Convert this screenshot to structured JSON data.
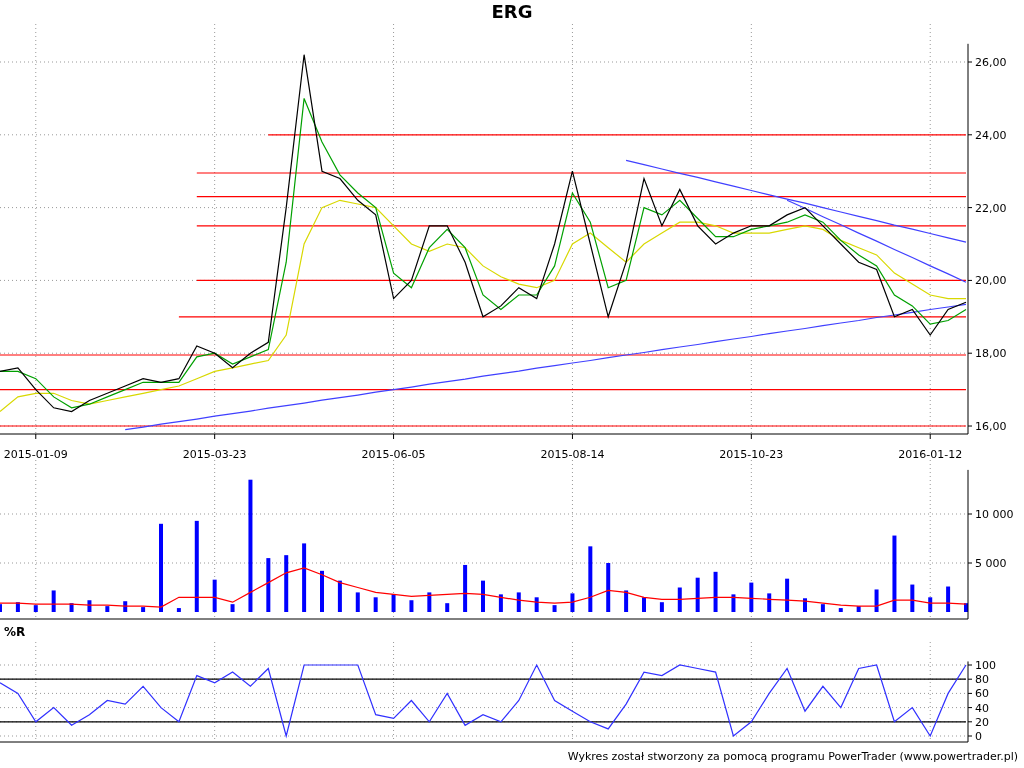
{
  "title": "ERG",
  "price_chart": {
    "chart_data": {
      "type": "line",
      "grid": true,
      "categories": [
        null,
        null,
        "2015-01-09",
        null,
        null,
        null,
        null,
        null,
        null,
        null,
        null,
        null,
        "2015-03-23",
        null,
        null,
        null,
        null,
        null,
        null,
        null,
        null,
        null,
        "2015-06-05",
        null,
        null,
        null,
        null,
        null,
        null,
        null,
        null,
        null,
        "2015-08-14",
        null,
        null,
        null,
        null,
        null,
        null,
        null,
        null,
        null,
        "2015-10-23",
        null,
        null,
        null,
        null,
        null,
        null,
        null,
        null,
        null,
        "2016-01-12",
        null,
        null
      ],
      "ylim": [
        15.8,
        26.5
      ],
      "yticks": [
        {
          "value": 16,
          "label": "16,00"
        },
        {
          "value": 18,
          "label": "18,00"
        },
        {
          "value": 20,
          "label": "20,00"
        },
        {
          "value": 22,
          "label": "22,00"
        },
        {
          "value": 24,
          "label": "24,00"
        },
        {
          "value": 26,
          "label": "26,00"
        }
      ],
      "series": [
        {
          "color": "#ff0000",
          "values": [
            null,
            null,
            null,
            null,
            null,
            null,
            null,
            null,
            null,
            null,
            null,
            null,
            null,
            null,
            null,
            24,
            24,
            24,
            24,
            24,
            24,
            24,
            24,
            24,
            24,
            24,
            24,
            24,
            24,
            24,
            24,
            24,
            24,
            24,
            24,
            24,
            24,
            24,
            24,
            24,
            24,
            24,
            24,
            24,
            24,
            24,
            24,
            24,
            24,
            24,
            24,
            24,
            24,
            24,
            24
          ]
        },
        {
          "color": "#ff0000",
          "values": [
            null,
            null,
            null,
            null,
            null,
            null,
            null,
            null,
            null,
            null,
            null,
            22.95,
            22.95,
            22.95,
            22.95,
            22.95,
            22.95,
            22.95,
            22.95,
            22.95,
            22.95,
            22.95,
            22.95,
            22.95,
            22.95,
            22.95,
            22.95,
            22.95,
            22.95,
            22.95,
            22.95,
            22.95,
            22.95,
            22.95,
            22.95,
            22.95,
            22.95,
            22.95,
            22.95,
            22.95,
            22.95,
            22.95,
            22.95,
            22.95,
            22.95,
            22.95,
            22.95,
            22.95,
            22.95,
            22.95,
            22.95,
            22.95,
            22.95,
            22.95,
            22.95
          ]
        },
        {
          "color": "#ff0000",
          "values": [
            null,
            null,
            null,
            null,
            null,
            null,
            null,
            null,
            null,
            null,
            null,
            22.3,
            22.3,
            22.3,
            22.3,
            22.3,
            22.3,
            22.3,
            22.3,
            22.3,
            22.3,
            22.3,
            22.3,
            22.3,
            22.3,
            22.3,
            22.3,
            22.3,
            22.3,
            22.3,
            22.3,
            22.3,
            22.3,
            22.3,
            22.3,
            22.3,
            22.3,
            22.3,
            22.3,
            22.3,
            22.3,
            22.3,
            22.3,
            22.3,
            22.3,
            22.3,
            22.3,
            22.3,
            22.3,
            22.3,
            22.3,
            22.3,
            22.3,
            22.3,
            22.3
          ]
        },
        {
          "color": "#ff0000",
          "values": [
            null,
            null,
            null,
            null,
            null,
            null,
            null,
            null,
            null,
            null,
            null,
            21.5,
            21.5,
            21.5,
            21.5,
            21.5,
            21.5,
            21.5,
            21.5,
            21.5,
            21.5,
            21.5,
            21.5,
            21.5,
            21.5,
            21.5,
            21.5,
            21.5,
            21.5,
            21.5,
            21.5,
            21.5,
            21.5,
            21.5,
            21.5,
            21.5,
            21.5,
            21.5,
            21.5,
            21.5,
            21.5,
            21.5,
            21.5,
            21.5,
            21.5,
            21.5,
            21.5,
            21.5,
            21.5,
            21.5,
            21.5,
            21.5,
            21.5,
            21.5,
            21.5
          ]
        },
        {
          "color": "#ff0000",
          "values": [
            null,
            null,
            null,
            null,
            null,
            null,
            null,
            null,
            null,
            null,
            null,
            20,
            20,
            20,
            20,
            20,
            20,
            20,
            20,
            20,
            20,
            20,
            20,
            20,
            20,
            20,
            20,
            20,
            20,
            20,
            20,
            20,
            20,
            20,
            20,
            20,
            20,
            20,
            20,
            20,
            20,
            20,
            20,
            20,
            20,
            20,
            20,
            20,
            20,
            20,
            20,
            20,
            20,
            20,
            20
          ]
        },
        {
          "color": "#ff0000",
          "values": [
            null,
            null,
            null,
            null,
            null,
            null,
            null,
            null,
            null,
            null,
            19,
            19,
            19,
            19,
            19,
            19,
            19,
            19,
            19,
            19,
            19,
            19,
            19,
            19,
            19,
            19,
            19,
            19,
            19,
            19,
            19,
            19,
            19,
            19,
            19,
            19,
            19,
            19,
            19,
            19,
            19,
            19,
            19,
            19,
            19,
            19,
            19,
            19,
            19,
            19,
            19,
            19,
            19,
            19,
            19
          ]
        },
        {
          "color": "#ff0000",
          "values": [
            17.95,
            17.95,
            17.95,
            17.95,
            17.95,
            17.95,
            17.95,
            17.95,
            17.95,
            17.95,
            17.95,
            17.95,
            17.95,
            17.95,
            17.95,
            17.95,
            17.95,
            17.95,
            17.95,
            17.95,
            17.95,
            17.95,
            17.95,
            17.95,
            17.95,
            17.95,
            17.95,
            17.95,
            17.95,
            17.95,
            17.95,
            17.95,
            17.95,
            17.95,
            17.95,
            17.95,
            17.95,
            17.95,
            17.95,
            17.95,
            17.95,
            17.95,
            17.95,
            17.95,
            17.95,
            17.95,
            17.95,
            17.95,
            17.95,
            17.95,
            17.95,
            17.95,
            17.95,
            17.95,
            17.95
          ]
        },
        {
          "color": "#ff0000",
          "values": [
            17,
            17,
            17,
            17,
            17,
            17,
            17,
            17,
            17,
            17,
            17,
            17,
            17,
            17,
            17,
            17,
            17,
            17,
            17,
            17,
            17,
            17,
            17,
            17,
            17,
            17,
            17,
            17,
            17,
            17,
            17,
            17,
            17,
            17,
            17,
            17,
            17,
            17,
            17,
            17,
            17,
            17,
            17,
            17,
            17,
            17,
            17,
            17,
            17,
            17,
            17,
            17,
            17,
            17,
            17
          ]
        },
        {
          "color": "#ff0000",
          "values": [
            16,
            16,
            16,
            16,
            16,
            16,
            16,
            16,
            16,
            16,
            16,
            16,
            16,
            16,
            16,
            16,
            16,
            16,
            16,
            16,
            16,
            16,
            16,
            16,
            16,
            16,
            16,
            16,
            16,
            16,
            16,
            16,
            16,
            16,
            16,
            16,
            16,
            16,
            16,
            16,
            16,
            16,
            16,
            16,
            16,
            16,
            16,
            16,
            16,
            16,
            16,
            16,
            16,
            16,
            16
          ]
        },
        {
          "color": "#4040ff",
          "values": [
            null,
            null,
            null,
            null,
            null,
            null,
            null,
            15.9,
            15.97,
            16.05,
            16.12,
            16.19,
            16.27,
            16.34,
            16.41,
            16.49,
            16.56,
            16.63,
            16.71,
            16.78,
            16.85,
            16.93,
            17.0,
            17.07,
            17.15,
            17.22,
            17.29,
            17.37,
            17.44,
            17.51,
            17.59,
            17.66,
            17.73,
            17.8,
            17.88,
            17.95,
            18.02,
            18.1,
            18.17,
            18.24,
            18.32,
            18.39,
            18.46,
            18.54,
            18.61,
            18.68,
            18.76,
            18.83,
            18.9,
            18.98,
            19.05,
            19.12,
            19.2,
            19.27,
            19.34
          ]
        },
        {
          "color": "#4040ff",
          "values": [
            null,
            null,
            null,
            null,
            null,
            null,
            null,
            null,
            null,
            null,
            null,
            null,
            null,
            null,
            null,
            null,
            null,
            null,
            null,
            null,
            null,
            null,
            null,
            null,
            null,
            null,
            null,
            null,
            null,
            null,
            null,
            null,
            null,
            null,
            null,
            23.3,
            23.18,
            23.06,
            22.94,
            22.83,
            22.71,
            22.59,
            22.47,
            22.35,
            22.23,
            22.12,
            22.0,
            21.88,
            21.76,
            21.64,
            21.52,
            21.41,
            21.29,
            21.17,
            21.05
          ]
        },
        {
          "color": "#4040ff",
          "values": [
            null,
            null,
            null,
            null,
            null,
            null,
            null,
            null,
            null,
            null,
            null,
            null,
            null,
            null,
            null,
            null,
            null,
            null,
            null,
            null,
            null,
            null,
            null,
            null,
            null,
            null,
            null,
            null,
            null,
            null,
            null,
            null,
            null,
            null,
            null,
            null,
            null,
            null,
            null,
            null,
            null,
            null,
            null,
            null,
            22.2,
            21.98,
            21.75,
            21.53,
            21.3,
            21.08,
            20.85,
            20.63,
            20.4,
            20.18,
            19.95
          ]
        },
        {
          "color": "#d8d800",
          "values": [
            16.4,
            16.8,
            16.9,
            16.9,
            16.7,
            16.6,
            16.7,
            16.8,
            16.9,
            17.0,
            17.1,
            17.3,
            17.5,
            17.6,
            17.7,
            17.8,
            18.5,
            21.0,
            22.0,
            22.2,
            22.1,
            22.0,
            21.5,
            21.0,
            20.8,
            21.0,
            20.9,
            20.4,
            20.1,
            19.9,
            19.8,
            20.0,
            21.0,
            21.3,
            20.9,
            20.5,
            21.0,
            21.3,
            21.6,
            21.6,
            21.5,
            21.3,
            21.3,
            21.3,
            21.4,
            21.5,
            21.4,
            21.1,
            20.9,
            20.7,
            20.2,
            19.9,
            19.6,
            19.5,
            19.5
          ]
        },
        {
          "color": "#00a000",
          "values": [
            17.5,
            17.5,
            17.3,
            16.8,
            16.5,
            16.6,
            16.8,
            17.0,
            17.2,
            17.2,
            17.2,
            17.9,
            18.0,
            17.7,
            17.9,
            18.1,
            20.5,
            25.0,
            23.8,
            22.9,
            22.4,
            22.0,
            20.2,
            19.8,
            20.9,
            21.4,
            20.9,
            19.6,
            19.2,
            19.6,
            19.6,
            20.4,
            22.4,
            21.6,
            19.8,
            20.0,
            22.0,
            21.8,
            22.2,
            21.7,
            21.2,
            21.2,
            21.4,
            21.5,
            21.6,
            21.8,
            21.6,
            21.1,
            20.7,
            20.4,
            19.6,
            19.3,
            18.8,
            18.9,
            19.2
          ]
        },
        {
          "color": "#000000",
          "values": [
            17.5,
            17.6,
            17.0,
            16.5,
            16.4,
            16.7,
            16.9,
            17.1,
            17.3,
            17.2,
            17.3,
            18.2,
            18.0,
            17.6,
            18.0,
            18.3,
            22.0,
            26.2,
            23.0,
            22.8,
            22.2,
            21.8,
            19.5,
            20.0,
            21.5,
            21.5,
            20.5,
            19.0,
            19.3,
            19.8,
            19.5,
            21.0,
            23.0,
            21.0,
            19.0,
            20.5,
            22.8,
            21.5,
            22.5,
            21.5,
            21.0,
            21.3,
            21.5,
            21.5,
            21.8,
            22.0,
            21.5,
            21.0,
            20.5,
            20.3,
            19.0,
            19.2,
            18.5,
            19.2,
            19.4
          ]
        }
      ]
    }
  },
  "volume_chart": {
    "chart_data": {
      "type": "bar",
      "grid": true,
      "categories": [
        null,
        null,
        null,
        null,
        null,
        null,
        null,
        null,
        null,
        null,
        null,
        null,
        null,
        null,
        null,
        null,
        null,
        null,
        null,
        null,
        null,
        null,
        null,
        null,
        null,
        null,
        null,
        null,
        null,
        null,
        null,
        null,
        null,
        null,
        null,
        null,
        null,
        null,
        null,
        null,
        null,
        null,
        null,
        null,
        null,
        null,
        null,
        null,
        null,
        null,
        null,
        null,
        null,
        null,
        null
      ],
      "ylim": [
        0,
        14500
      ],
      "yticks": [
        {
          "value": 5000,
          "label": "5 000"
        },
        {
          "value": 10000,
          "label": "10 000"
        }
      ],
      "series": [
        {
          "color": "#0000ff",
          "values": [
            800,
            1000,
            700,
            2200,
            900,
            1200,
            600,
            1100,
            500,
            9000,
            400,
            9300,
            3300,
            800,
            13500,
            5500,
            5800,
            7000,
            4200,
            3200,
            2000,
            1500,
            1800,
            1200,
            2000,
            900,
            4800,
            3200,
            1800,
            2000,
            1500,
            700,
            1900,
            6700,
            5000,
            2200,
            1500,
            1000,
            2500,
            3500,
            4100,
            1800,
            3000,
            1900,
            3400,
            1400,
            800,
            400,
            600,
            2300,
            7800,
            2800,
            1500,
            2600,
            900
          ]
        },
        {
          "type": "line",
          "color": "#ff0000",
          "values": [
            900,
            900,
            800,
            800,
            800,
            700,
            700,
            600,
            600,
            500,
            1500,
            1500,
            1500,
            1000,
            2000,
            3000,
            4000,
            4500,
            3800,
            3000,
            2500,
            2000,
            1800,
            1600,
            1700,
            1800,
            1900,
            1800,
            1500,
            1200,
            1000,
            900,
            1000,
            1500,
            2200,
            2000,
            1500,
            1300,
            1300,
            1400,
            1500,
            1500,
            1400,
            1300,
            1200,
            1100,
            900,
            700,
            600,
            600,
            1200,
            1200,
            900,
            900,
            800
          ]
        }
      ]
    }
  },
  "williams_r": {
    "label": "%R",
    "chart_data": {
      "type": "line",
      "grid": true,
      "categories": [
        null,
        null,
        null,
        null,
        null,
        null,
        null,
        null,
        null,
        null,
        null,
        null,
        null,
        null,
        null,
        null,
        null,
        null,
        null,
        null,
        null,
        null,
        null,
        null,
        null,
        null,
        null,
        null,
        null,
        null,
        null,
        null,
        null,
        null,
        null,
        null,
        null,
        null,
        null,
        null,
        null,
        null,
        null,
        null,
        null,
        null,
        null,
        null,
        null,
        null,
        null,
        null,
        null,
        null,
        null
      ],
      "ylim": [
        0,
        105
      ],
      "yticks": [
        0,
        20,
        40,
        60,
        80,
        100
      ],
      "series": [
        {
          "color": "#000000",
          "values": [
            20,
            20,
            20,
            20,
            20,
            20,
            20,
            20,
            20,
            20,
            20,
            20,
            20,
            20,
            20,
            20,
            20,
            20,
            20,
            20,
            20,
            20,
            20,
            20,
            20,
            20,
            20,
            20,
            20,
            20,
            20,
            20,
            20,
            20,
            20,
            20,
            20,
            20,
            20,
            20,
            20,
            20,
            20,
            20,
            20,
            20,
            20,
            20,
            20,
            20,
            20,
            20,
            20,
            20,
            20
          ]
        },
        {
          "color": "#000000",
          "values": [
            80,
            80,
            80,
            80,
            80,
            80,
            80,
            80,
            80,
            80,
            80,
            80,
            80,
            80,
            80,
            80,
            80,
            80,
            80,
            80,
            80,
            80,
            80,
            80,
            80,
            80,
            80,
            80,
            80,
            80,
            80,
            80,
            80,
            80,
            80,
            80,
            80,
            80,
            80,
            80,
            80,
            80,
            80,
            80,
            80,
            80,
            80,
            80,
            80,
            80,
            80,
            80,
            80,
            80,
            80
          ]
        },
        {
          "color": "#3030ff",
          "values": [
            75,
            60,
            20,
            40,
            15,
            30,
            50,
            45,
            70,
            40,
            20,
            85,
            75,
            90,
            70,
            95,
            0,
            100,
            100,
            100,
            100,
            30,
            25,
            50,
            20,
            60,
            15,
            30,
            20,
            50,
            100,
            50,
            35,
            20,
            10,
            45,
            90,
            85,
            100,
            95,
            90,
            0,
            20,
            60,
            95,
            35,
            70,
            40,
            95,
            100,
            20,
            40,
            0,
            60,
            100
          ]
        }
      ]
    }
  },
  "footer": "Wykres został stworzony za pomocą programu PowerTrader (www.powertrader.pl)"
}
